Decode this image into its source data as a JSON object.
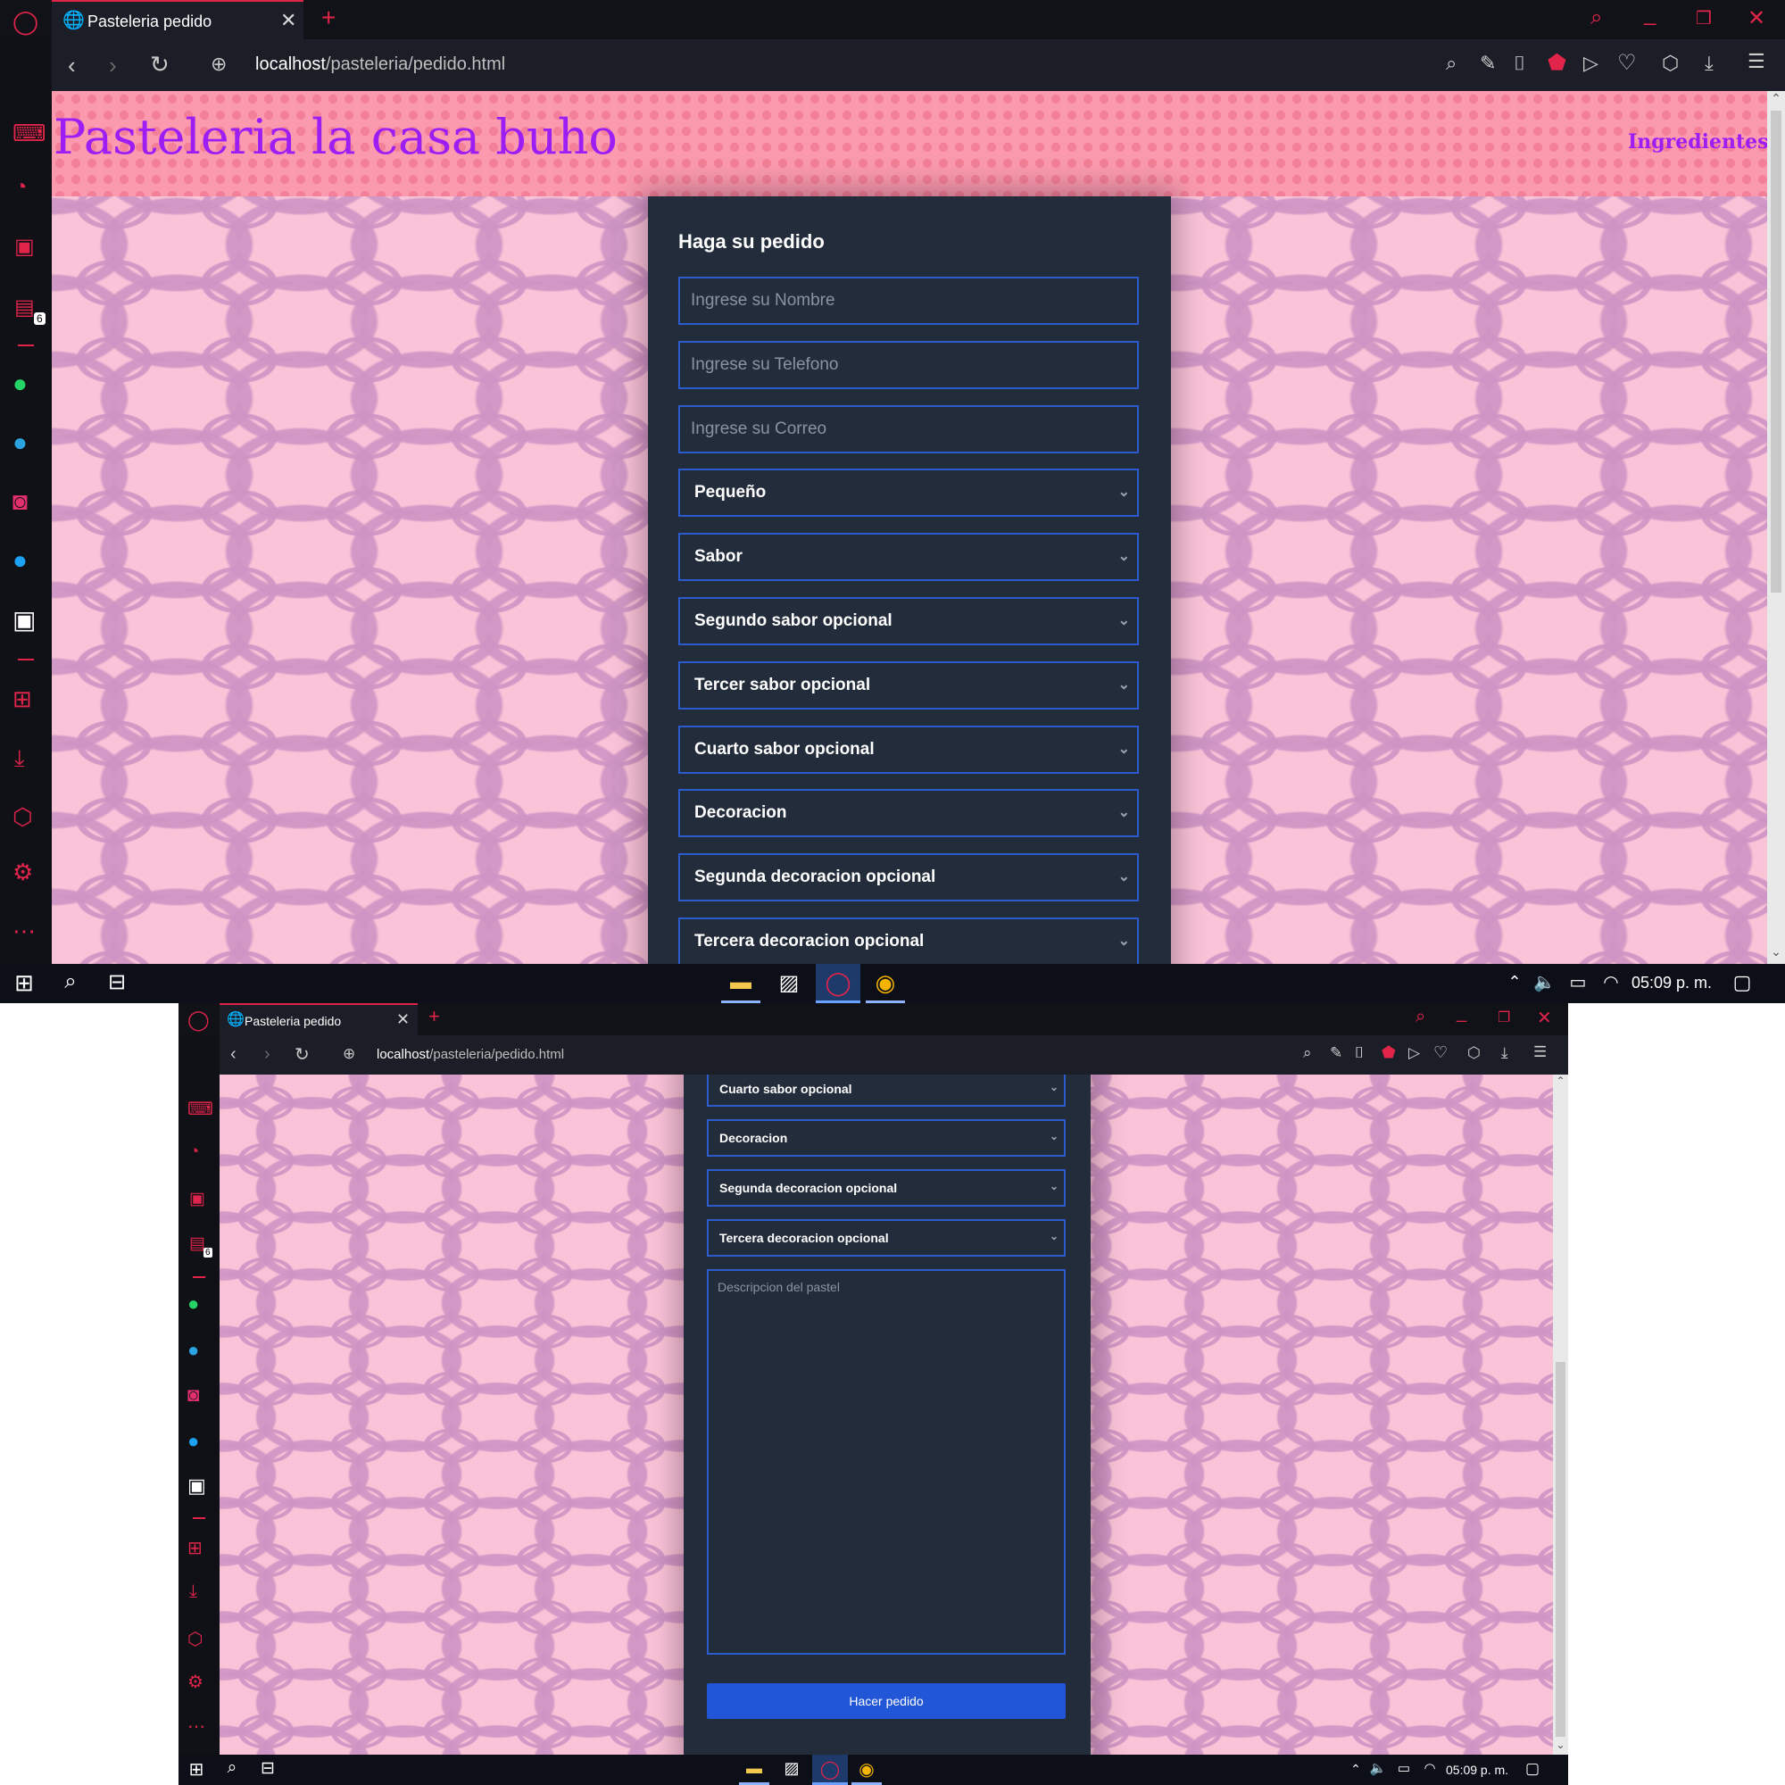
{
  "browser": {
    "tab_title": "Pasteleria pedido",
    "url_host": "localhost",
    "url_path": "/pasteleria/pedido.html",
    "sidebar_badge": "6"
  },
  "site": {
    "title": "Pasteleria la casa buho",
    "nav_link": "Ingredientes"
  },
  "form": {
    "heading": "Haga su pedido",
    "name_placeholder": "Ingrese su Nombre",
    "phone_placeholder": "Ingrese su Telefono",
    "email_placeholder": "Ingrese su Correo",
    "size": "Pequeño",
    "flavor": "Sabor",
    "flavor2": "Segundo sabor opcional",
    "flavor3": "Tercer sabor opcional",
    "flavor4": "Cuarto sabor opcional",
    "decoration": "Decoracion",
    "decoration2": "Segunda decoracion opcional",
    "decoration3": "Tercera decoracion opcional",
    "description_placeholder": "Descripcion del pastel",
    "submit_label": "Hacer pedido"
  },
  "taskbar": {
    "clock": "05:09 p. m."
  },
  "colors": {
    "accent": "#e0244a",
    "title": "#9d1df5",
    "panel": "#232c3a",
    "field_border": "#2d5bd0",
    "submit": "#2156d6",
    "page_bg": "#fac4d8"
  },
  "icons": {
    "browser": [
      "opera-icon",
      "globe-icon",
      "close-icon",
      "plus-icon",
      "search-icon",
      "minimize-icon",
      "restore-icon",
      "back-icon",
      "forward-icon",
      "reload-icon",
      "snapshot-icon",
      "adblock-icon",
      "heart-icon",
      "download-icon",
      "menu-icon"
    ],
    "sidebar": [
      "gamepad-icon",
      "speed-dial-icon",
      "briefcase-icon",
      "twitch-icon",
      "whatsapp-icon",
      "telegram-icon",
      "instagram-icon",
      "twitter-icon",
      "discord-icon",
      "apps-icon",
      "downloads-icon",
      "box-icon",
      "settings-icon",
      "more-icon"
    ],
    "taskbar": [
      "windows-start-icon",
      "search-icon",
      "task-view-icon",
      "file-explorer-icon",
      "photos-icon",
      "opera-icon",
      "chrome-icon",
      "chevron-up-icon",
      "volume-icon",
      "battery-icon",
      "wifi-icon",
      "notifications-icon"
    ]
  }
}
